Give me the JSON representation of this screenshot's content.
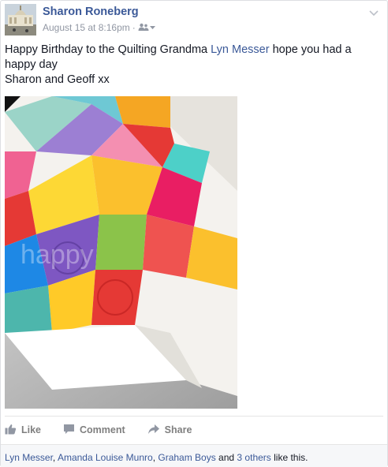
{
  "post": {
    "author": "Sharon Roneberg",
    "timestamp": "August 15 at 8:16pm",
    "separator": "·",
    "audience_icon": "friends-icon",
    "message": {
      "line1_before": "Happy Birthday to the Quilting Grandma ",
      "mention": "Lyn Messer",
      "line1_after": " hope you had a happy day",
      "line2": "Sharon and Geoff xx"
    },
    "photo_watermark": "happy"
  },
  "actions": {
    "like": "Like",
    "comment": "Comment",
    "share": "Share"
  },
  "likes": {
    "names": [
      "Lyn Messer",
      "Amanda Louise Munro",
      "Graham Boys"
    ],
    "sep1": ", ",
    "sep2": ", ",
    "and": " and ",
    "others": "3 others",
    "suffix": " like this."
  },
  "colors": {
    "link": "#3b5998",
    "muted": "#9197a3",
    "action": "#7f7f7f"
  }
}
